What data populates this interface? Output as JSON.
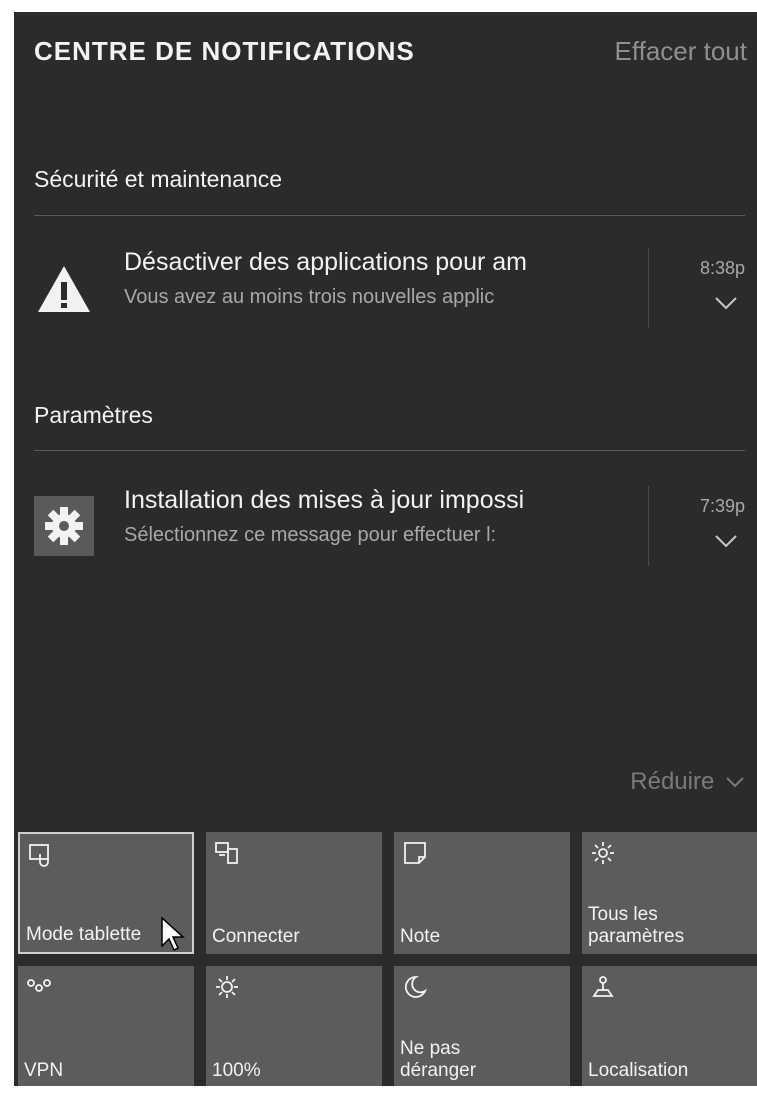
{
  "header": {
    "title": "CENTRE DE NOTIFICATIONS",
    "clear_all": "Effacer tout"
  },
  "groups": [
    {
      "name": "Sécurité et maintenance",
      "notification": {
        "icon": "warning-icon",
        "title": "Désactiver des applications pour am",
        "body": "Vous avez au moins trois nouvelles applic",
        "time": "8:38p"
      }
    },
    {
      "name": "Paramètres",
      "notification": {
        "icon": "gear-icon",
        "title": "Installation des mises à jour impossi",
        "body": "Sélectionnez ce message pour effectuer l:",
        "time": "7:39p"
      }
    }
  ],
  "collapse": {
    "label": "Réduire"
  },
  "quick_actions": [
    {
      "label": "Mode tablette",
      "icon": "tablet-mode-icon",
      "active": true
    },
    {
      "label": "Connecter",
      "icon": "connect-icon"
    },
    {
      "label": "Note",
      "icon": "note-icon"
    },
    {
      "label": "Tous les\nparamètres",
      "icon": "settings-icon"
    },
    {
      "label": "VPN",
      "icon": "vpn-icon"
    },
    {
      "label": "100%",
      "icon": "brightness-icon"
    },
    {
      "label": "Ne pas\ndéranger",
      "icon": "moon-icon"
    },
    {
      "label": "Localisation",
      "icon": "location-icon"
    }
  ]
}
